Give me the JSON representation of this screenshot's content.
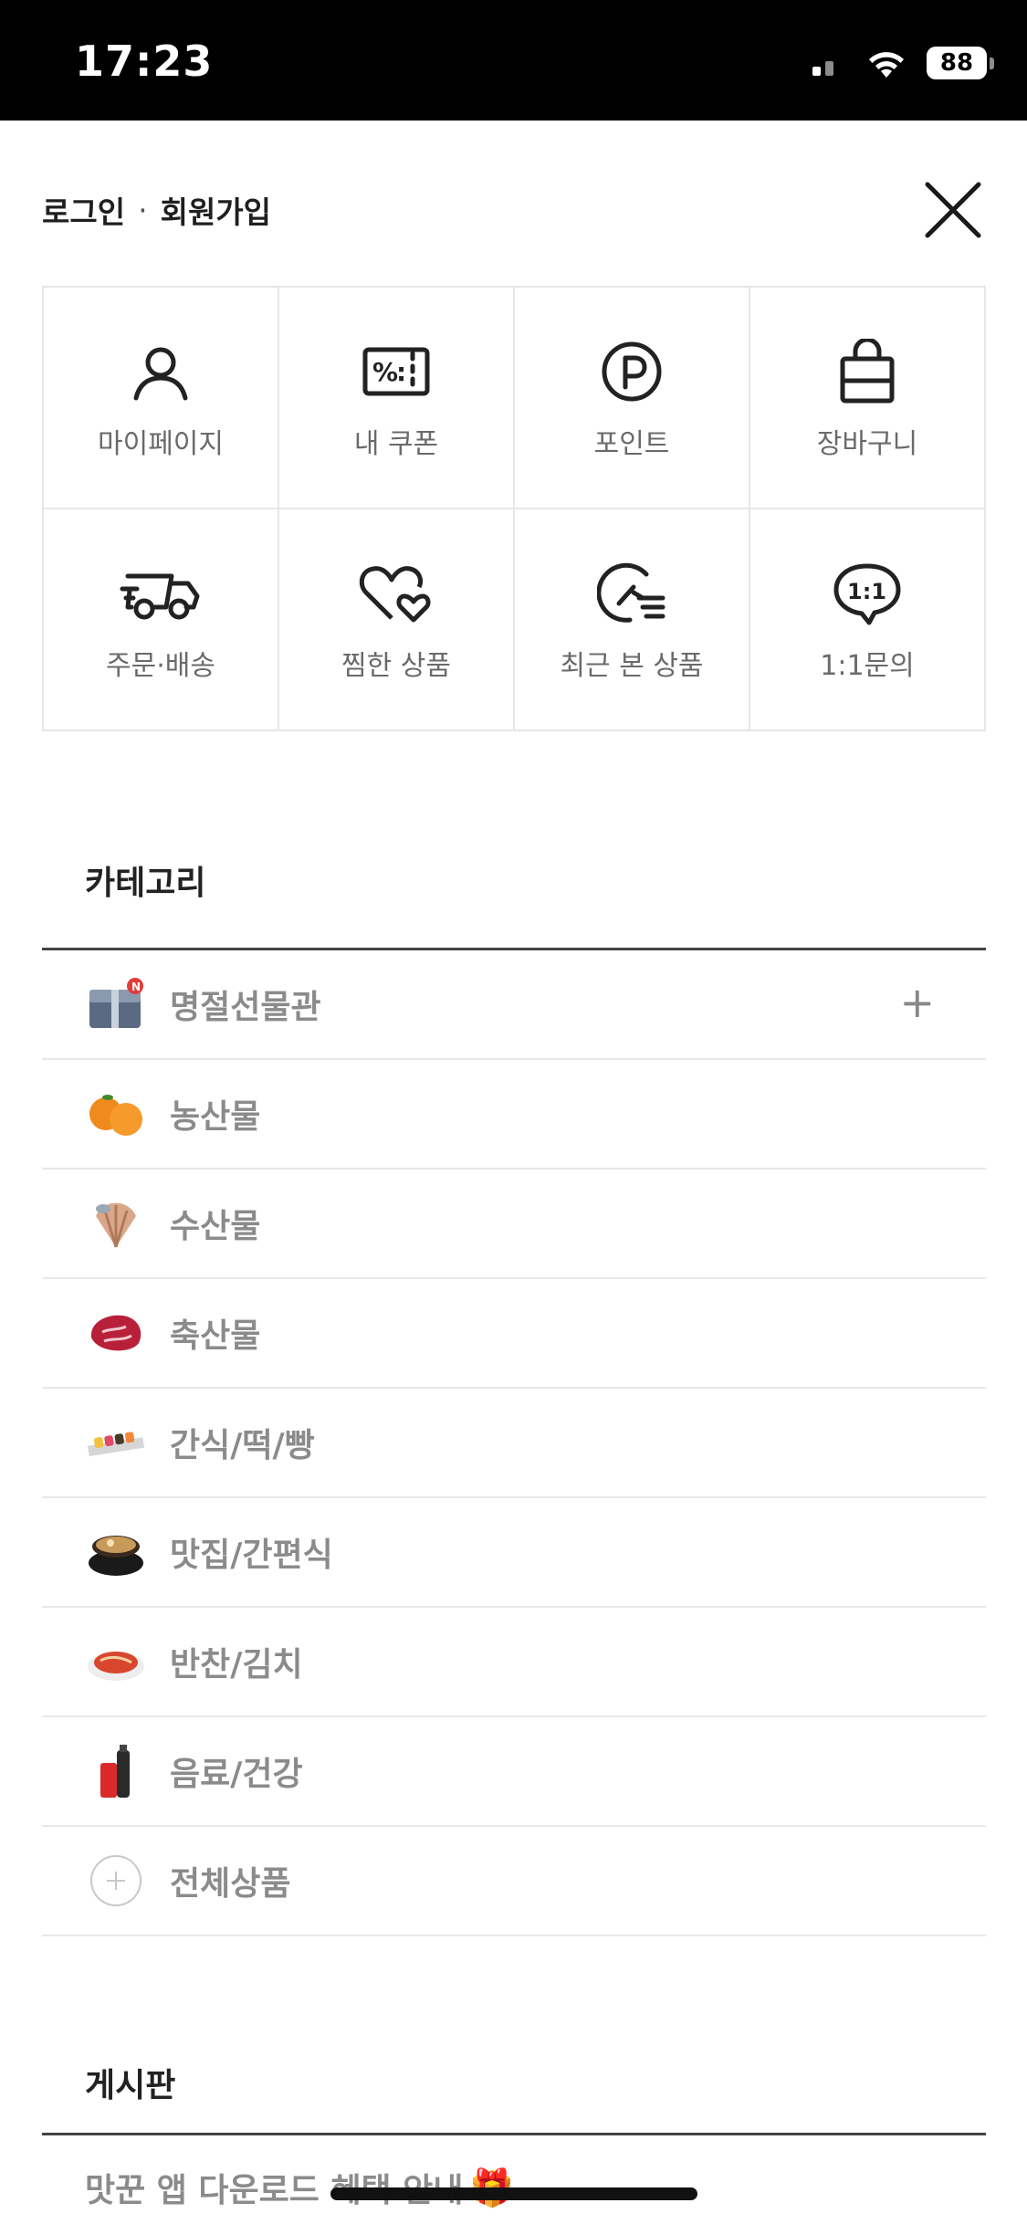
{
  "status_bar": {
    "time": "17:23",
    "battery": "88"
  },
  "header": {
    "login": "로그인",
    "separator": "·",
    "signup": "회원가입"
  },
  "quick_menu": [
    {
      "label": "마이페이지",
      "icon": "person-icon"
    },
    {
      "label": "내 쿠폰",
      "icon": "coupon-icon"
    },
    {
      "label": "포인트",
      "icon": "point-icon"
    },
    {
      "label": "장바구니",
      "icon": "shopping-bag-icon"
    },
    {
      "label": "주문·배송",
      "icon": "delivery-truck-icon"
    },
    {
      "label": "찜한 상품",
      "icon": "heart-icon"
    },
    {
      "label": "최근 본 상품",
      "icon": "recent-view-icon"
    },
    {
      "label": "1:1문의",
      "icon": "chat-bubble-icon"
    }
  ],
  "categories": {
    "title": "카테고리",
    "items": [
      {
        "label": "명절선물관",
        "icon": "gift-box-icon",
        "expand": "+"
      },
      {
        "label": "농산물",
        "icon": "orange-icon"
      },
      {
        "label": "수산물",
        "icon": "shellfish-icon"
      },
      {
        "label": "축산물",
        "icon": "meat-icon"
      },
      {
        "label": "간식/떡/빵",
        "icon": "rice-cake-icon"
      },
      {
        "label": "맛집/간편식",
        "icon": "stew-pot-icon"
      },
      {
        "label": "반찬/김치",
        "icon": "kimchi-icon"
      },
      {
        "label": "음료/건강",
        "icon": "drink-bottle-icon"
      },
      {
        "label": "전체상품",
        "icon": "plus-circle-icon"
      }
    ]
  },
  "board": {
    "title": "게시판",
    "item": "맛꾼 앱 다운로드 혜택 안내",
    "item_emoji": "🎁"
  },
  "colors": {
    "accent_text": "#222222",
    "muted_text": "#8b8b8b",
    "divider": "#e8e8e8",
    "status_bar_bg": "#000000"
  }
}
